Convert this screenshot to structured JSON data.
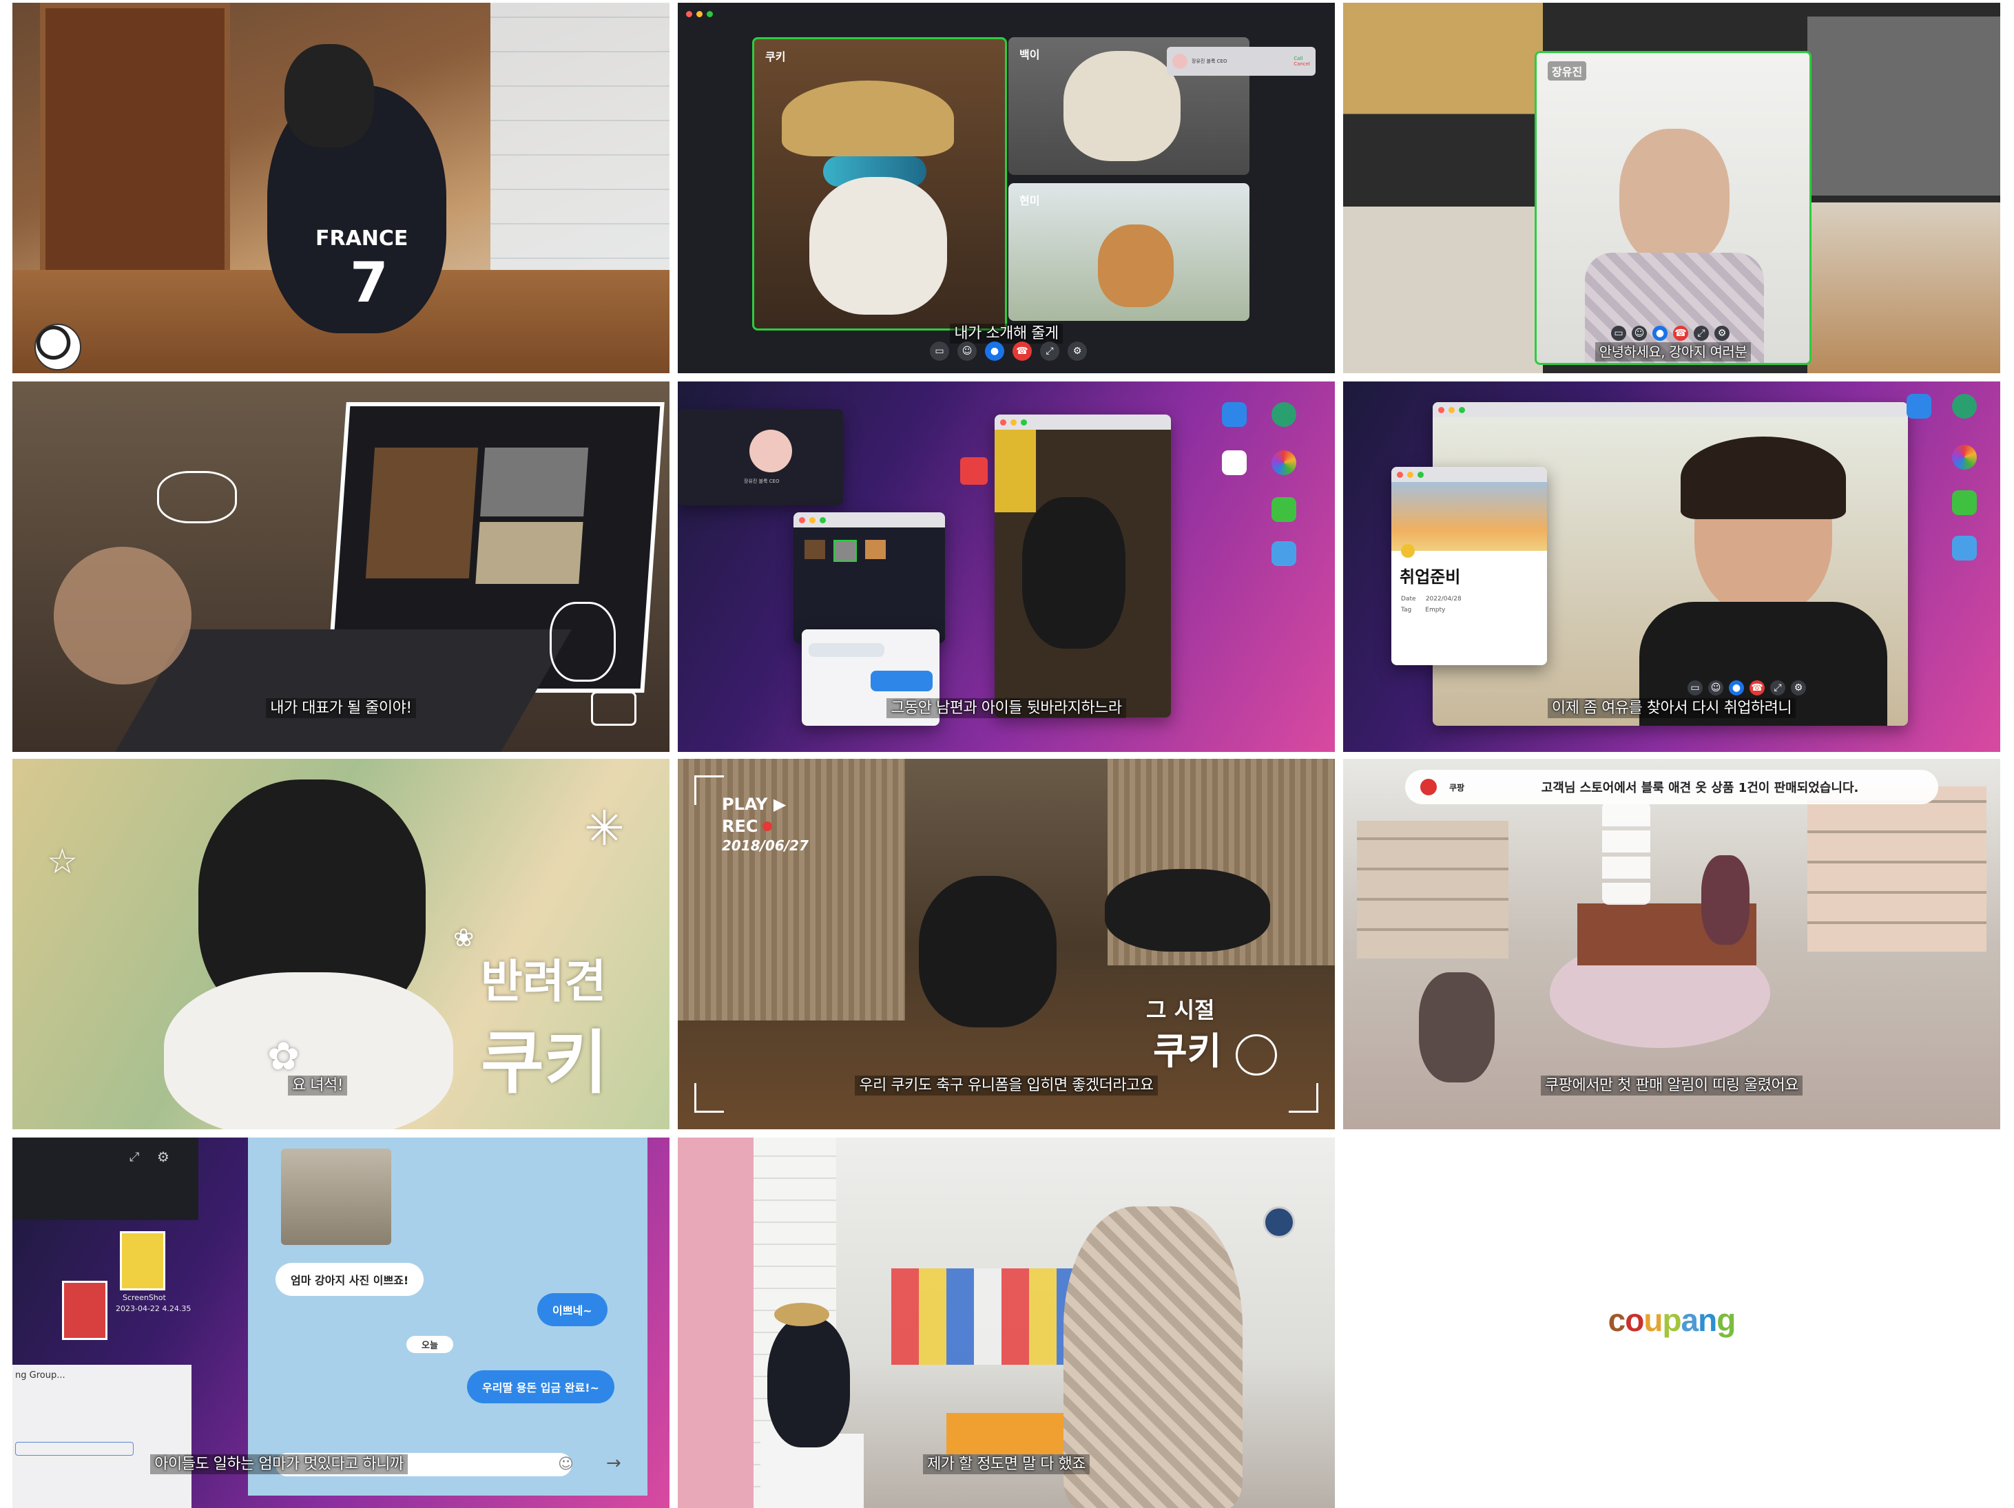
{
  "panels": {
    "p1": {
      "jersey_text": "FRANCE",
      "jersey_number": "7"
    },
    "p2": {
      "tiles": [
        "쿠키",
        "백이",
        "현미"
      ],
      "caller_label": "장유진 블룩 CEO",
      "call_label": "Call",
      "cancel_label": "Cancel",
      "subtitle": "내가 소개해 줄게"
    },
    "p3": {
      "name": "장유진",
      "subtitle": "안녕하세요, 강아지 여러분"
    },
    "p4": {
      "subtitle": "내가 대표가 될 줄이야!"
    },
    "p5": {
      "profile_label": "장유진 블룩 CEO",
      "subtitle": "그동안 남편과 아이들 뒷바라지하느라"
    },
    "p6": {
      "card_title": "취업준비",
      "date_label": "Date",
      "date_value": "2022/04/28",
      "tag_label": "Tag",
      "tag_value": "Empty",
      "subtitle": "이제 좀 여유를 찾아서 다시 취업하려니"
    },
    "p7": {
      "title_line1": "반려견",
      "title_line2": "쿠키",
      "subtitle": "요 녀석!"
    },
    "p8": {
      "play": "PLAY ▶",
      "rec": "REC",
      "date": "2018/06/27",
      "overlay_line1": "그 시절",
      "overlay_line2": "쿠키",
      "subtitle": "우리 쿠키도 축구 유니폼을 입히면 좋겠더라고요"
    },
    "p9": {
      "app_name": "쿠팡",
      "notification": "고객님 스토어에서 블룩 애견 옷 상품 1건이 판매되었습니다.",
      "subtitle": "쿠팡에서만 첫 판매 알림이 띠링 울렸어요"
    },
    "p10": {
      "screenshot_label": "ScreenShot",
      "screenshot_date": "2023-04-22 4.24.35",
      "tab_label": "ng Group...",
      "messages": [
        "엄마 강아지 사진 이쁘죠!",
        "이쁘네~",
        "오늘",
        "우리딸 용돈 입금 완료!~"
      ],
      "subtitle": "아이들도 일하는 엄마가 멋있다고 하니까"
    },
    "p11": {
      "subtitle": "제가 할 정도면 말 다 했죠"
    },
    "p12": {
      "logo": "coupang"
    }
  },
  "colors": {
    "coupang_c": "#a0592a",
    "coupang_o": "#c8312c",
    "coupang_u": "#e4a431",
    "coupang_p": "#a3c53c",
    "coupang_a": "#4e9ad4",
    "coupang_n": "#2e8fd0",
    "coupang_g": "#7cbb3f"
  }
}
